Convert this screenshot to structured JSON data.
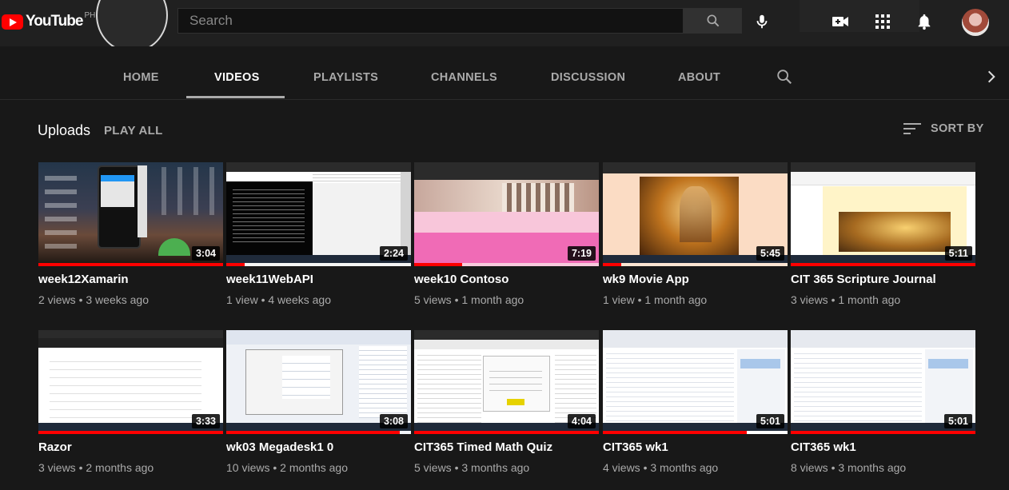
{
  "masthead": {
    "logo_text": "YouTube",
    "country": "PH",
    "search_placeholder": "Search",
    "icons": [
      "search-icon",
      "mic-icon",
      "create-video-icon",
      "apps-icon",
      "notifications-icon",
      "avatar"
    ]
  },
  "tabs": [
    {
      "label": "HOME"
    },
    {
      "label": "VIDEOS",
      "active": true
    },
    {
      "label": "PLAYLISTS"
    },
    {
      "label": "CHANNELS"
    },
    {
      "label": "DISCUSSION"
    },
    {
      "label": "ABOUT"
    }
  ],
  "shelf": {
    "title": "Uploads",
    "play_all": "PLAY ALL",
    "sort_by": "SORT BY"
  },
  "videos": [
    {
      "title": "week12Xamarin",
      "views": "2 views",
      "age": "3 weeks ago",
      "duration": "3:04",
      "progress": 1.0
    },
    {
      "title": "week11WebAPI",
      "views": "1 view",
      "age": "4 weeks ago",
      "duration": "2:24",
      "progress": 0.1
    },
    {
      "title": "week10 Contoso",
      "views": "5 views",
      "age": "1 month ago",
      "duration": "7:19",
      "progress": 0.26
    },
    {
      "title": "wk9 Movie App",
      "views": "1 view",
      "age": "1 month ago",
      "duration": "5:45",
      "progress": 0.1
    },
    {
      "title": "CIT 365 Scripture Journal",
      "views": "3 views",
      "age": "1 month ago",
      "duration": "5:11",
      "progress": 1.0
    },
    {
      "title": "Razor",
      "views": "3 views",
      "age": "2 months ago",
      "duration": "3:33",
      "progress": 1.0
    },
    {
      "title": "wk03 Megadesk1 0",
      "views": "10 views",
      "age": "2 months ago",
      "duration": "3:08",
      "progress": 0.94
    },
    {
      "title": "CIT365 Timed Math Quiz",
      "views": "5 views",
      "age": "3 months ago",
      "duration": "4:04",
      "progress": 1.0
    },
    {
      "title": "CIT365 wk1",
      "views": "4 views",
      "age": "3 months ago",
      "duration": "5:01",
      "progress": 0.78
    },
    {
      "title": "CIT365 wk1",
      "views": "8 views",
      "age": "3 months ago",
      "duration": "5:01",
      "progress": 1.0
    }
  ],
  "colors": {
    "brand": "#ff0000",
    "background": "#181818",
    "masthead": "#202020",
    "secondary_text": "#aaaaaa"
  }
}
